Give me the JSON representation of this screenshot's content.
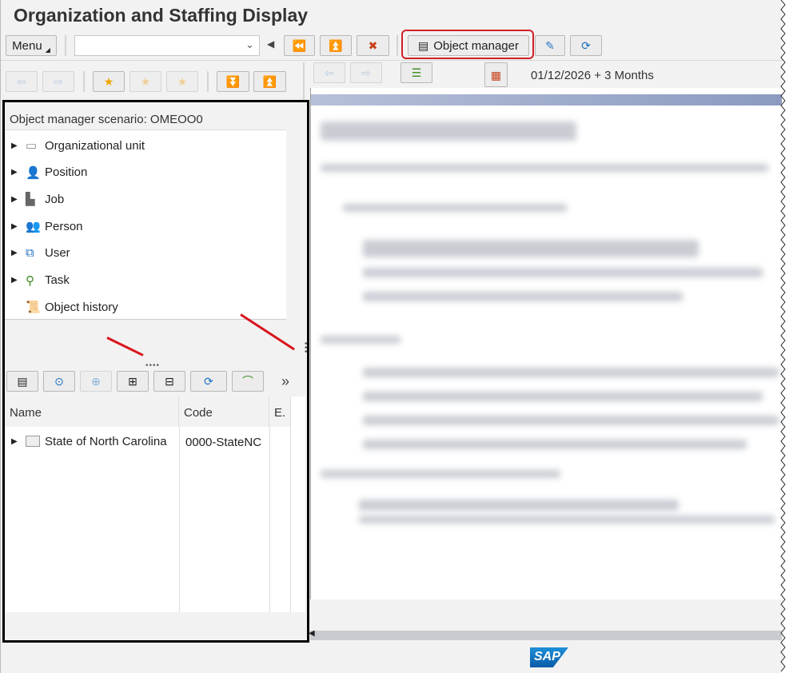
{
  "title": "Organization and Staffing Display",
  "toolbar": {
    "menu_label": "Menu",
    "command_value": "",
    "object_manager_label": "Object manager"
  },
  "date_range": "01/12/2026  + 3 Months",
  "scenario": "Object manager scenario: OMEOO0",
  "tree": [
    {
      "label": "Organizational unit",
      "icon": "org-unit-icon"
    },
    {
      "label": "Position",
      "icon": "position-icon"
    },
    {
      "label": "Job",
      "icon": "job-icon"
    },
    {
      "label": "Person",
      "icon": "person-icon"
    },
    {
      "label": "User",
      "icon": "user-icon"
    },
    {
      "label": "Task",
      "icon": "task-icon"
    },
    {
      "label": "Object history",
      "icon": "history-icon"
    }
  ],
  "table": {
    "headers": [
      "Name",
      "Code",
      "E."
    ],
    "rows": [
      {
        "name": "State of North Carolina",
        "code": "0000-StateNC"
      }
    ]
  },
  "more_label": "»",
  "logo": "SAP",
  "colors": {
    "highlight": "#d0202a",
    "arrow": "#d8141c"
  }
}
